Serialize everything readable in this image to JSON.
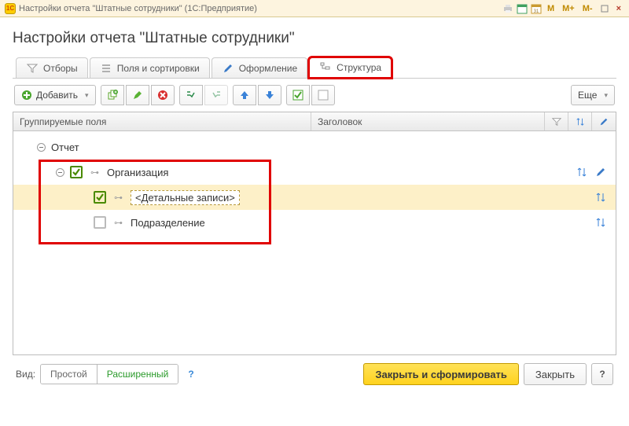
{
  "window": {
    "app_icon_text": "1C",
    "title": "Настройки отчета \"Штатные сотрудники\"  (1С:Предприятие)",
    "buttons": {
      "m": "M",
      "m_plus": "M+",
      "m_minus": "M-",
      "minimize": "—",
      "close": "×"
    }
  },
  "page_title": "Настройки отчета \"Штатные сотрудники\"",
  "tabs": {
    "filters": "Отборы",
    "fields": "Поля и сортировки",
    "design": "Оформление",
    "structure": "Структура"
  },
  "toolbar": {
    "add_label": "Добавить",
    "more_label": "Еще"
  },
  "grid": {
    "col_group": "Группируемые поля",
    "col_title": "Заголовок",
    "rows": {
      "r0": "Отчет",
      "r1": "Организация",
      "r2": "<Детальные записи>",
      "r3": "Подразделение"
    }
  },
  "footer": {
    "view_label": "Вид:",
    "simple": "Простой",
    "extended": "Расширенный",
    "help": "?",
    "primary": "Закрыть и сформировать",
    "close": "Закрыть",
    "q": "?"
  }
}
